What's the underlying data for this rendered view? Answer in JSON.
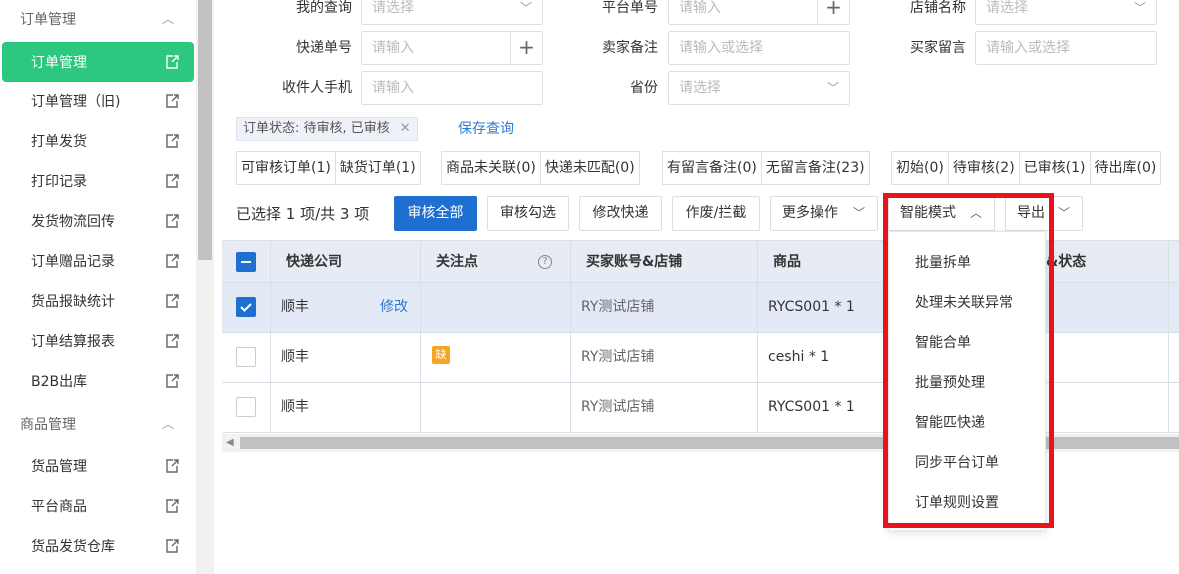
{
  "sidebar": {
    "groups": [
      {
        "label": "订单管理"
      },
      {
        "label": "商品管理"
      }
    ],
    "order_items": [
      {
        "label": "订单管理"
      },
      {
        "label": "订单管理（旧)"
      },
      {
        "label": "打单发货"
      },
      {
        "label": "打印记录"
      },
      {
        "label": "发货物流回传"
      },
      {
        "label": "订单赠品记录"
      },
      {
        "label": "货品报缺统计"
      },
      {
        "label": "订单结算报表"
      },
      {
        "label": "B2B出库"
      }
    ],
    "goods_items": [
      {
        "label": "货品管理"
      },
      {
        "label": "平台商品"
      },
      {
        "label": "货品发货仓库"
      }
    ]
  },
  "filters": {
    "my_query": {
      "label": "我的查询",
      "placeholder": "请选择"
    },
    "platform_no": {
      "label": "平台单号",
      "placeholder": "请输入"
    },
    "shop_name": {
      "label": "店铺名称",
      "placeholder": "请选择"
    },
    "express_no": {
      "label": "快递单号",
      "placeholder": "请输入"
    },
    "seller_note": {
      "label": "卖家备注",
      "placeholder": "请输入或选择"
    },
    "buyer_msg": {
      "label": "买家留言",
      "placeholder": "请输入或选择"
    },
    "receiver_phone": {
      "label": "收件人手机",
      "placeholder": "请输入"
    },
    "province": {
      "label": "省份",
      "placeholder": "请选择"
    }
  },
  "active_tag": "订单状态: 待审核, 已审核",
  "save_query": "保存查询",
  "status_tabs": {
    "group1": [
      "可审核订单(1)",
      "缺货订单(1)"
    ],
    "group2": [
      "商品未关联(0)",
      "快递未匹配(0)"
    ],
    "group3": [
      "有留言备注(0)",
      "无留言备注(23)"
    ],
    "group4": [
      "初始(0)",
      "待审核(2)",
      "已审核(1)",
      "待出库(0)"
    ]
  },
  "toolbar": {
    "selection_info": "已选择 1 项/共 3 项",
    "audit_all": "审核全部",
    "audit_checked": "审核勾选",
    "modify_express": "修改快递",
    "void_intercept": "作废/拦截",
    "more_actions": "更多操作",
    "smart_mode": "智能模式",
    "export": "导出"
  },
  "table": {
    "headers": {
      "express": "快递公司",
      "focus": "关注点",
      "buyer_shop": "买家账号&店铺",
      "goods": "商品",
      "order_status": "单号&状态"
    },
    "rows": [
      {
        "express": "顺丰",
        "edit": "修改",
        "focus_badge": "",
        "shop": "RY测试店铺",
        "goods": "RYCS001 * 1",
        "checked": true
      },
      {
        "express": "顺丰",
        "edit": "",
        "focus_badge": "缺",
        "shop": "RY测试店铺",
        "goods": "ceshi * 1",
        "checked": false
      },
      {
        "express": "顺丰",
        "edit": "",
        "focus_badge": "",
        "shop": "RY测试店铺",
        "goods": "RYCS001 * 1",
        "checked": false
      }
    ]
  },
  "smart_mode_menu": [
    "批量拆单",
    "处理未关联异常",
    "智能合单",
    "批量预处理",
    "智能匹快递",
    "同步平台订单",
    "订单规则设置"
  ],
  "colors": {
    "active_green": "#2ec77f",
    "primary_blue": "#1f6fd0",
    "highlight_red": "#e8141a",
    "badge_orange": "#f5a623"
  }
}
